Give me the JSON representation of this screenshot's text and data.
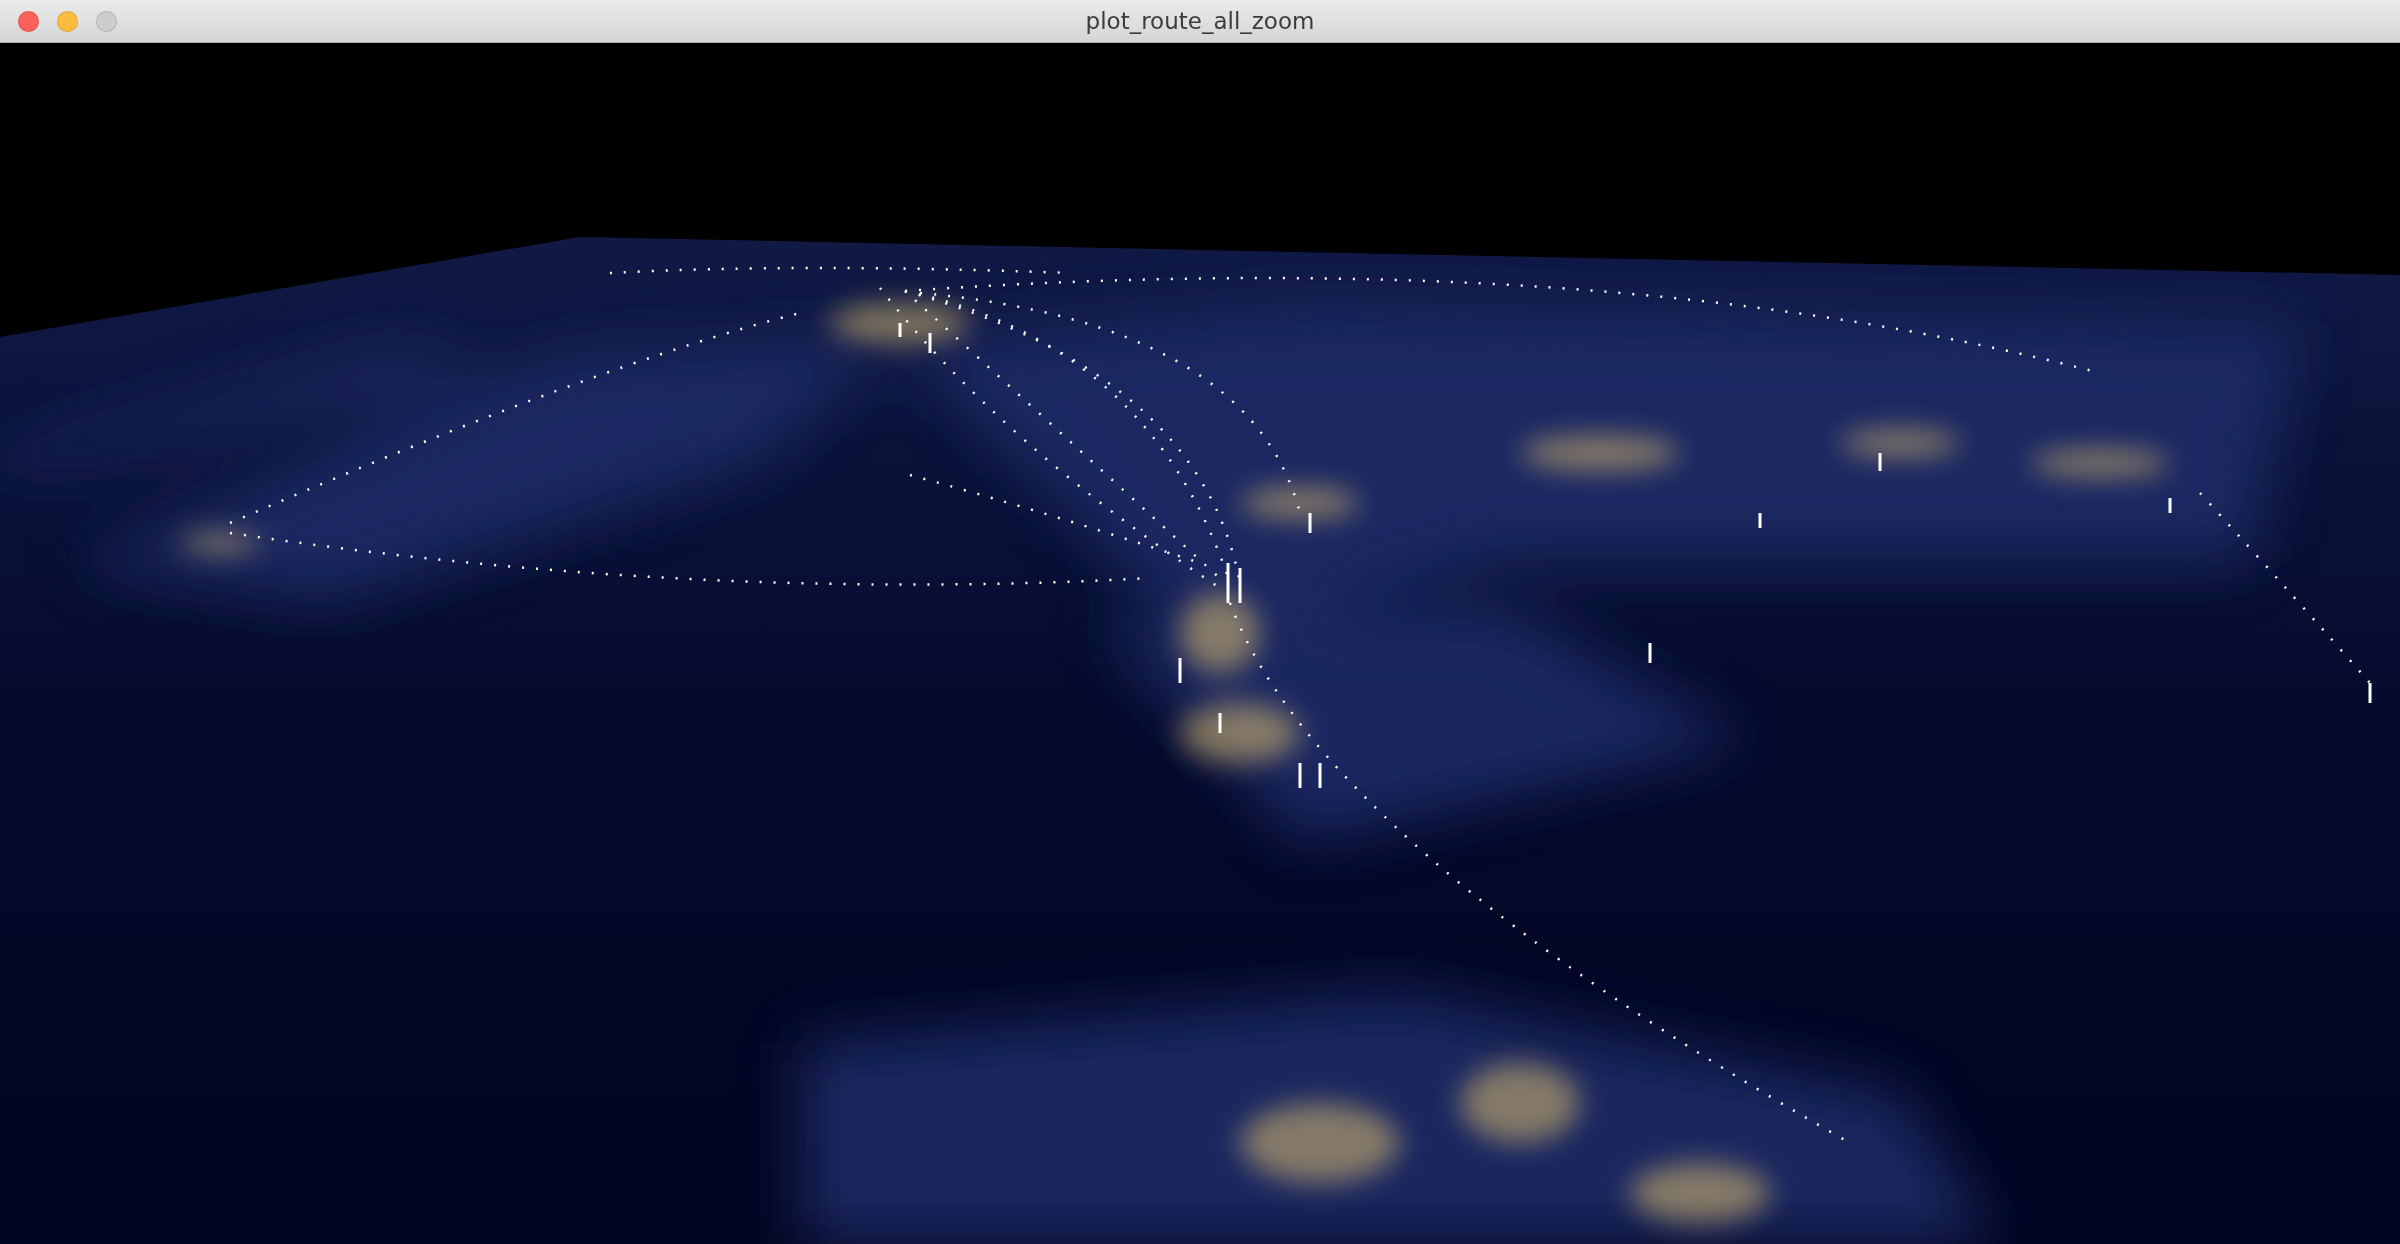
{
  "window": {
    "title": "plot_route_all_zoom",
    "buttons": [
      {
        "kind": "close",
        "disabled": false
      },
      {
        "kind": "minimize",
        "disabled": false
      },
      {
        "kind": "zoom",
        "disabled": true
      }
    ]
  }
}
